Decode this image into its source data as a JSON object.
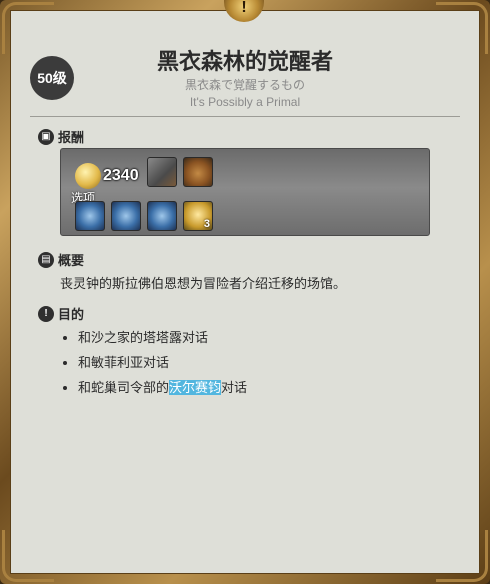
{
  "quest": {
    "level": "50级",
    "title": "黑衣森林的觉醒者",
    "subtitle_jp": "黒衣森で覚醒するもの",
    "subtitle_en": "It's Possibly a Primal"
  },
  "rewards": {
    "heading": "报酬",
    "gil": "2340",
    "options_label": "选项",
    "item_count": "3"
  },
  "summary": {
    "heading": "概要",
    "text": "丧灵钟的斯拉佛伯恩想为冒险者介绍迁移的场馆。"
  },
  "objectives": {
    "heading": "目的",
    "items": [
      "和沙之家的塔塔露对话",
      "和敏菲利亚对话"
    ],
    "item3_prefix": "和蛇巢司令部的",
    "item3_highlight": "沃尔赛钧",
    "item3_suffix": "对话"
  },
  "icons": {
    "crest": "exclamation-crest-icon",
    "rewards": "chest-icon",
    "summary": "book-icon",
    "objectives": "exclamation-icon"
  },
  "colors": {
    "panel_bg": "#dedfd8",
    "highlight": "#52b6df",
    "frame_gold": "#c9a25e"
  }
}
